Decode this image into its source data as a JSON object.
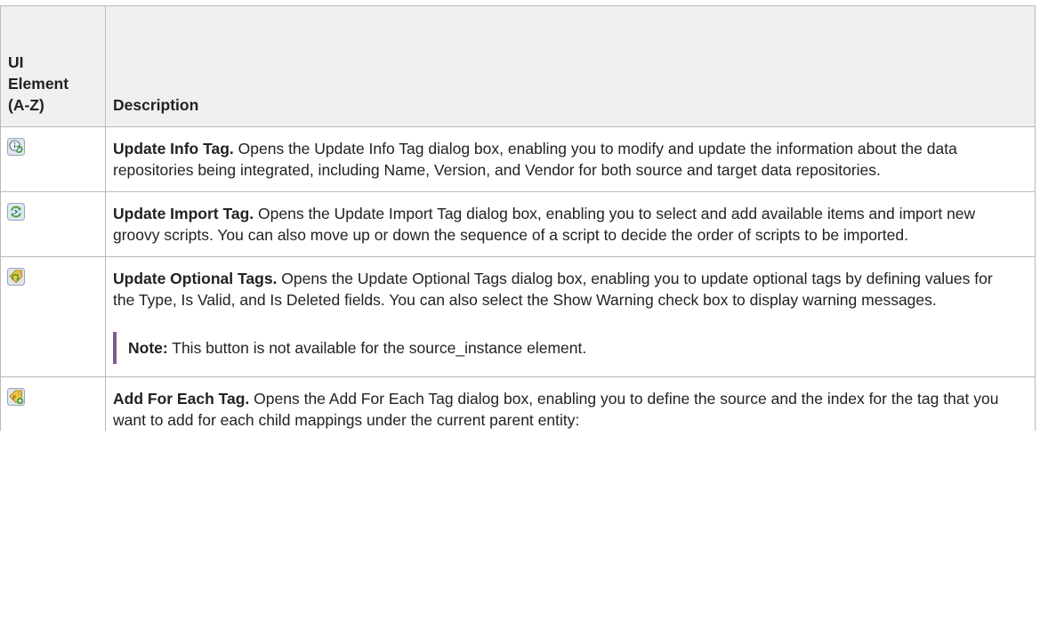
{
  "table": {
    "header": {
      "ui_element": [
        "UI",
        "Element",
        "(A-Z)"
      ],
      "description": "Description"
    },
    "rows": [
      {
        "icon": "update-info-tag-icon",
        "title": "Update Info Tag.",
        "text": " Opens the Update Info Tag dialog box, enabling you to modify and update the information about the data repositories being integrated, including Name, Version, and Vendor for both source and target data repositories."
      },
      {
        "icon": "update-import-tag-icon",
        "title": "Update Import Tag.",
        "text": " Opens the Update Import Tag dialog box, enabling you to select and add available items and import new groovy scripts. You can also move up or down the sequence of a script to decide the order of scripts to be imported."
      },
      {
        "icon": "update-optional-tags-icon",
        "title": "Update Optional Tags.",
        "text": " Opens the Update Optional Tags dialog box, enabling you to update optional tags by defining values for the Type, Is Valid, and Is Deleted fields. You can also select the Show Warning check box to display warning messages.",
        "note_label": "Note:",
        "note_text": " This button is not available for the source_instance element."
      },
      {
        "icon": "add-for-each-tag-icon",
        "title": "Add For Each Tag.",
        "text": " Opens the Add For Each Tag dialog box, enabling you to define the source and the index for the tag that you want to add for each child mappings under the current parent entity:"
      }
    ]
  },
  "colors": {
    "header_bg": "#f0f0f0",
    "border": "#b9b9b9",
    "note_bar": "#7a5c86",
    "text": "#222222"
  }
}
